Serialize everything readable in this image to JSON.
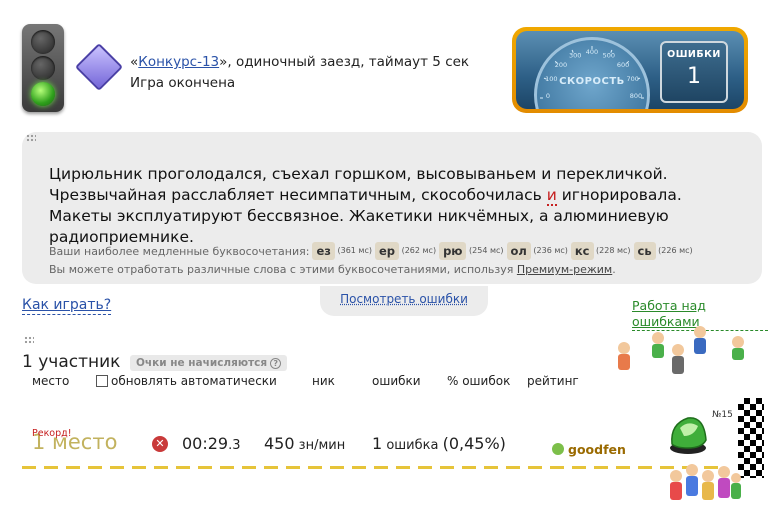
{
  "race": {
    "link": "Конкурс-13",
    "open_quote": "«",
    "rest": "», одиночный заезд, таймаут 5 сек",
    "status": "Игра окончена"
  },
  "speedometer": {
    "label": "СКОРОСТЬ",
    "ticks": [
      "0",
      "100",
      "200",
      "300",
      "400",
      "500",
      "600",
      "700",
      "800"
    ],
    "errors_label": "ОШИБКИ",
    "errors_value": "1"
  },
  "text": {
    "part1": "Цирюльник проголодался, съехал горшком, высовываньем и перекличкой. Чрезвычайная расслабляет несимпатичным, скособочилась ",
    "error_char": "и",
    "part2": " игнорировала. Макеты эксплуатируют бессвязное. Жакетики никчёмных, а алюминиевую радиоприемнике."
  },
  "slow": {
    "label": "Ваши наиболее медленные буквосочетания:",
    "combos": [
      {
        "c": "ез",
        "ms": "(361 мс)"
      },
      {
        "c": "ер",
        "ms": "(262 мс)"
      },
      {
        "c": "рю",
        "ms": "(254 мс)"
      },
      {
        "c": "ол",
        "ms": "(236 мс)"
      },
      {
        "c": "кс",
        "ms": "(228 мс)"
      },
      {
        "c": "сь",
        "ms": "(226 мс)"
      }
    ],
    "hint": "Вы можете отработать различные слова с этими буквосочетаниями, используя ",
    "premium": "Премиум-режим",
    "hint_end": "."
  },
  "links": {
    "view_errors": "Посмотреть ошибки",
    "how_to_play": "Как играть?",
    "work_on_errors": "Работа над ошибками"
  },
  "results": {
    "participants": "1 участник",
    "badge": "Очки не начисляются",
    "badge_q": "?",
    "columns": {
      "place": "место",
      "auto": "обновлять автоматически",
      "nick": "ник",
      "errors": "ошибки",
      "err_pct": "% ошибок",
      "rating": "рейтинг"
    },
    "row": {
      "record": "Рекорд!",
      "place": "1 место",
      "time_main": "00:29",
      "time_frac": ".3",
      "speed_val": "450",
      "speed_unit": " зн/мин",
      "err_count": "1",
      "err_word": " ошибка ",
      "err_pct": "(0,45%)",
      "nick": "goodfen",
      "car_num": "№15"
    }
  },
  "colors": {
    "link": "#2a52a8",
    "green_link": "#2a8a2a",
    "place": "#c2b25e",
    "error": "#c62020"
  }
}
